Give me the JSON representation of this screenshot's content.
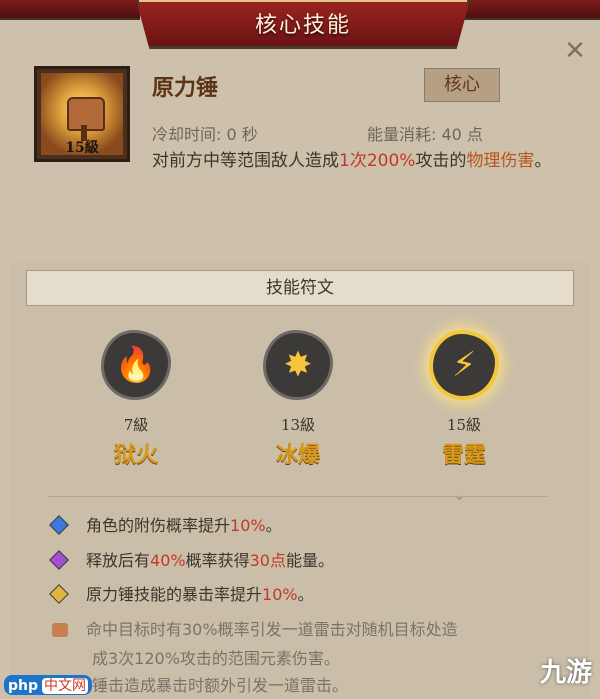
{
  "dialog": {
    "title": "核心技能"
  },
  "skill": {
    "name": "原力锤",
    "level_label": "15級",
    "badge": "核心",
    "cooldown": "冷却时间: 0 秒",
    "energy": "能量消耗: 40 点",
    "description_parts": [
      "对前方中等范围敌人造成",
      "1次",
      "200%",
      "攻击的",
      "物理伤害",
      "。"
    ]
  },
  "runes": {
    "header": "技能符文",
    "items": [
      {
        "level": "7級",
        "name": "狱火",
        "icon": "flame-icon",
        "selected": false
      },
      {
        "level": "13級",
        "name": "冰爆",
        "icon": "ice-burst-icon",
        "selected": false
      },
      {
        "level": "15級",
        "name": "雷霆",
        "icon": "thunder-icon",
        "selected": true
      }
    ]
  },
  "effects": [
    {
      "parts": [
        "角色的附伤概率提升",
        "10%",
        "。"
      ],
      "color": "#3a7ad8",
      "dim": false
    },
    {
      "parts": [
        "释放后有",
        "40%",
        "概率获得",
        "30点",
        "能量。"
      ],
      "color": "#a44fd1",
      "dim": false
    },
    {
      "parts": [
        "原力锤技能的暴击率提升",
        "10%",
        "。"
      ],
      "color": "#e0b43a",
      "dim": false
    },
    {
      "lines": [
        "命中目标时有30%概率引发一道雷击对随机目标处造",
        "成3次120%攻击的范围元素伤害。",
        "锤击造成暴击时额外引发一道雷击。"
      ],
      "dim": true
    }
  ],
  "watermarks": {
    "left_brand": "php",
    "left_text": "中文网",
    "right": "九游"
  },
  "colors": {
    "banner": "#8a1e1c",
    "highlight": "#c0392b",
    "rune_name": "#d99a1c"
  }
}
